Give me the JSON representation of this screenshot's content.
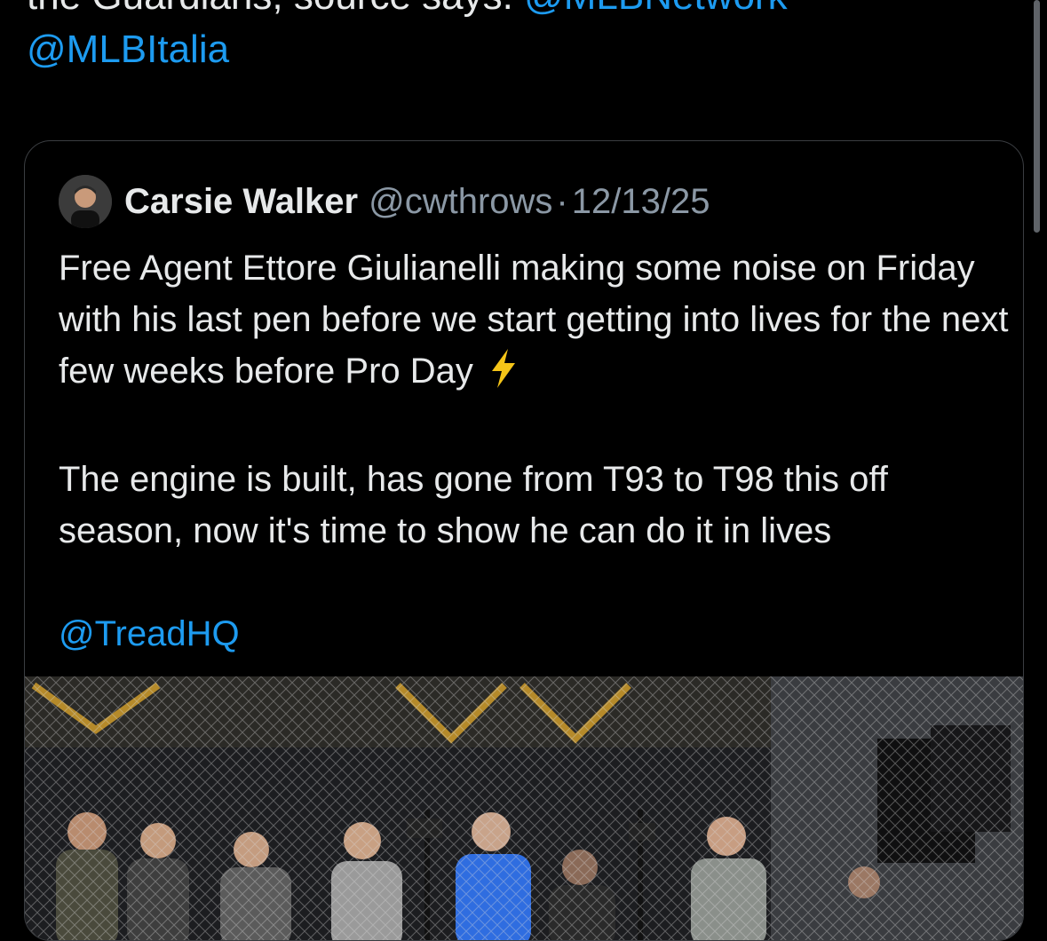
{
  "parent_tweet": {
    "text_cut": "the Guardians, source says.",
    "text_cut_link": "@MLBNetwork",
    "mention": "@MLBItalia"
  },
  "quoted_tweet": {
    "author_name": "Carsie Walker",
    "author_handle": "@cwthrows",
    "separator": "·",
    "date": "12/13/25",
    "paragraph_1": "Free Agent Ettore Giulianelli making some noise on Friday with his last pen before we start getting into lives for the next few weeks before Pro Day",
    "emoji": "lightning-emoji",
    "paragraph_2": "The engine is built, has gone from T93 to T98 this off season, now it's time to show he can do it in lives",
    "mention": "@TreadHQ"
  },
  "media": {
    "icon": "photo-media",
    "colors": {
      "net": "#d9d9d9",
      "bg": "#1c1d20",
      "gold": "#b58a2a",
      "blue": "#2f6de0"
    }
  }
}
